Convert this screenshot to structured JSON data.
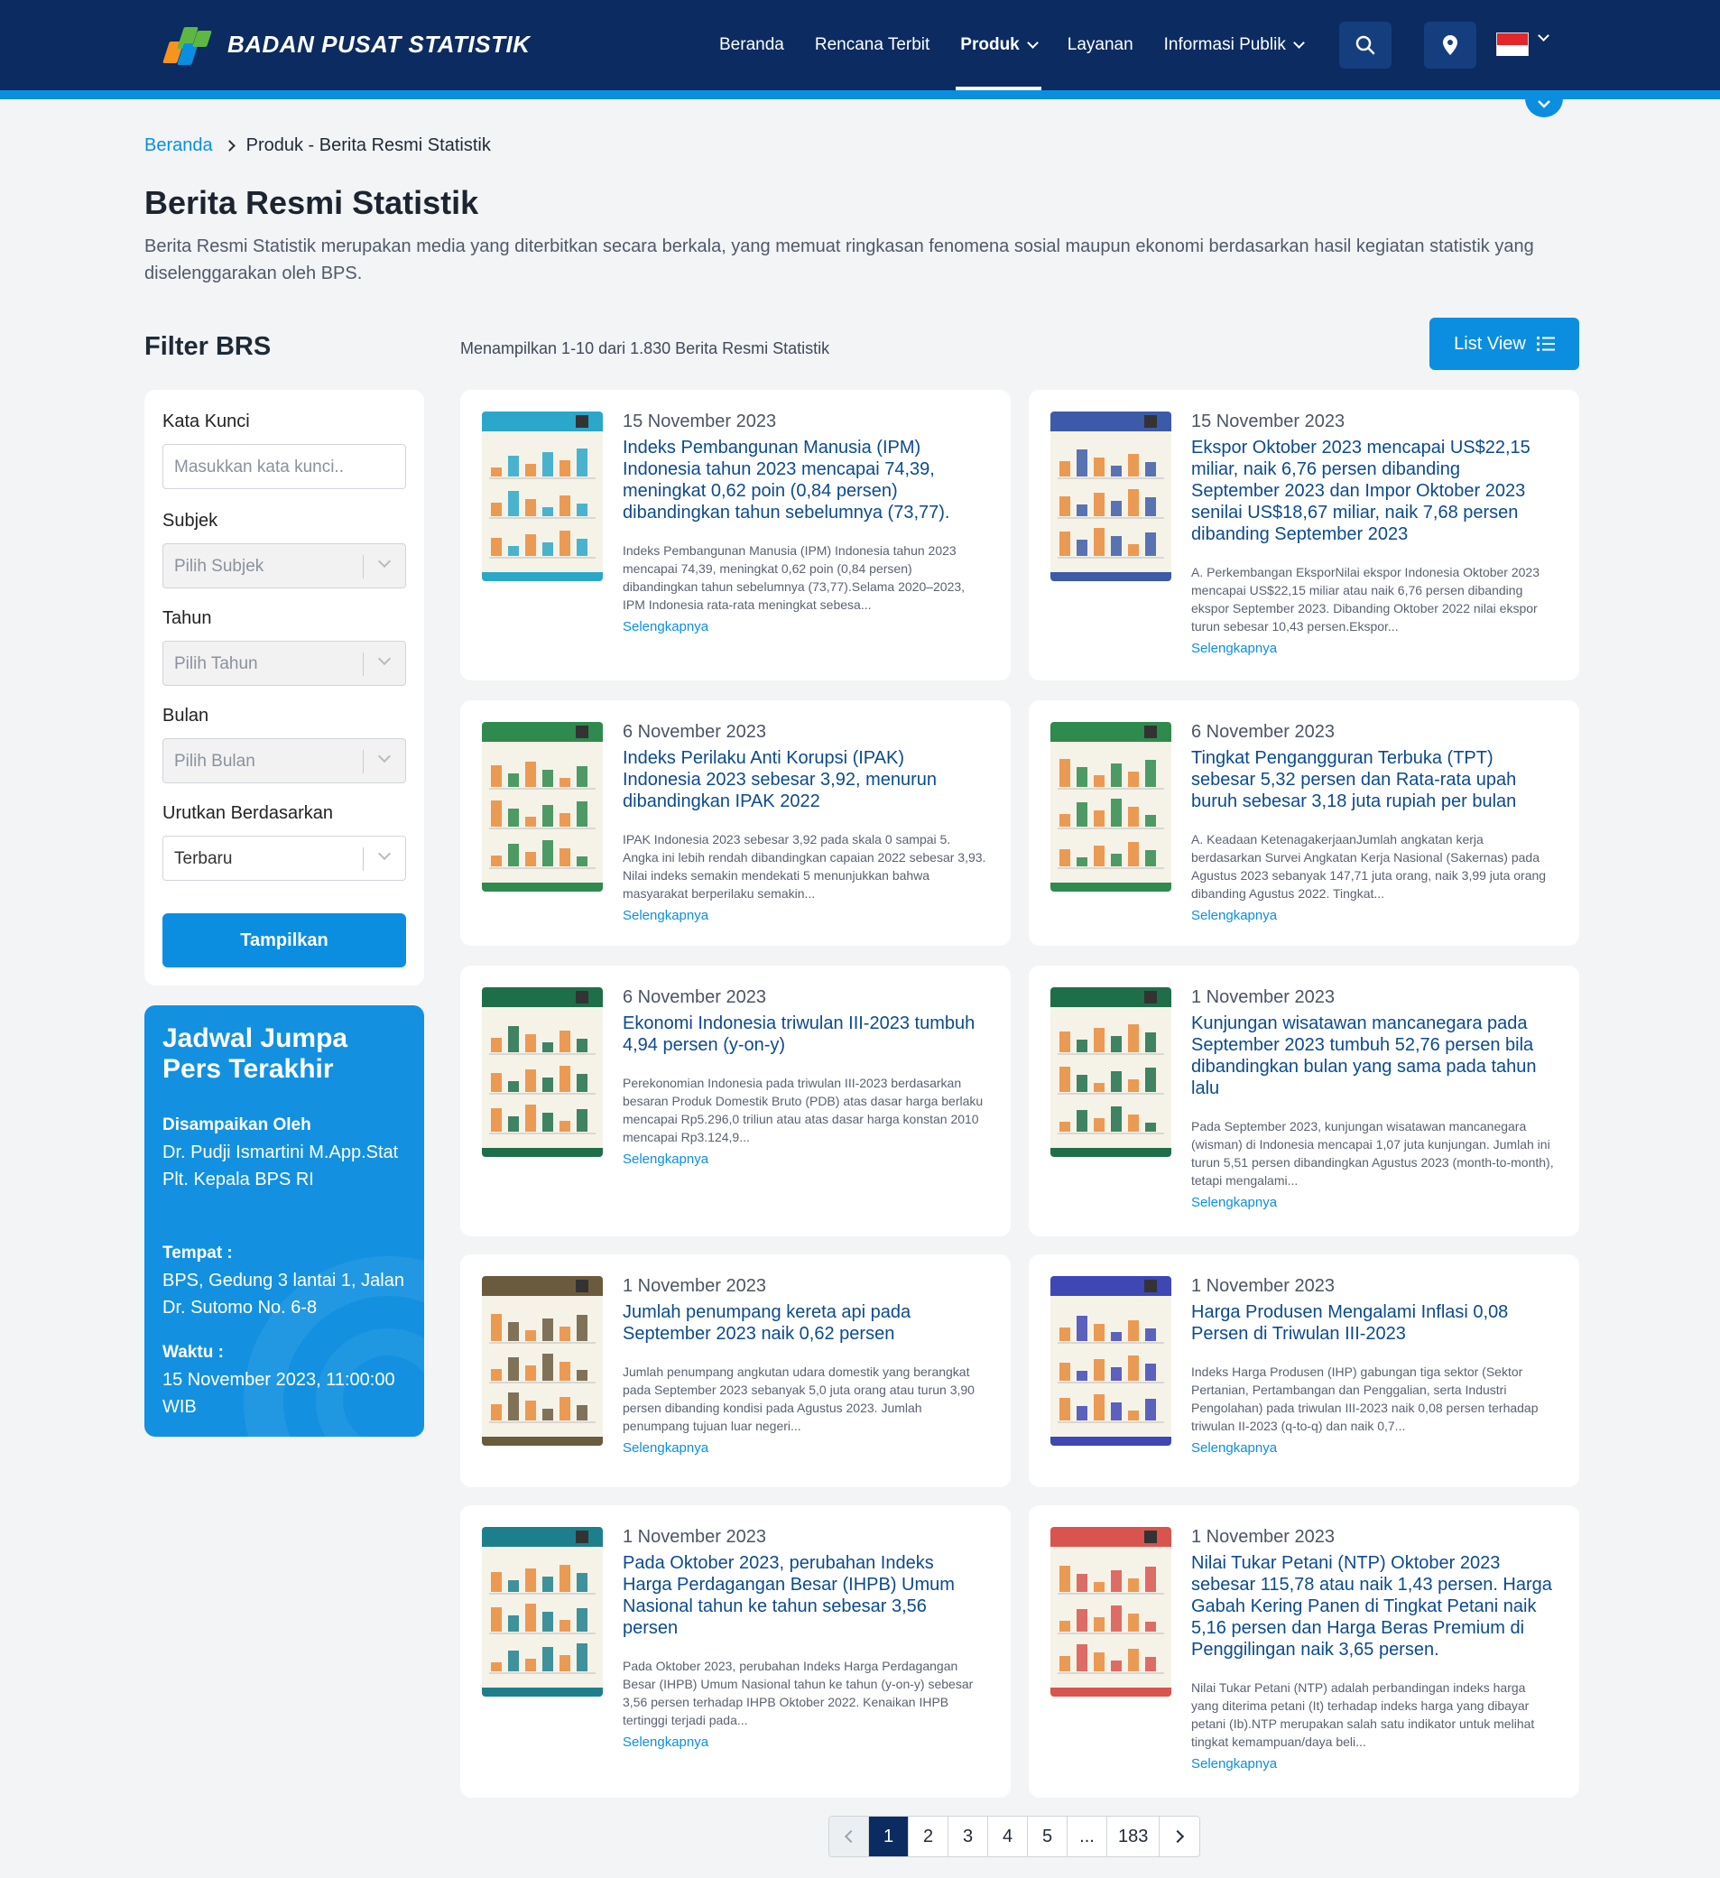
{
  "header": {
    "brand": "BADAN PUSAT STATISTIK",
    "nav": [
      {
        "label": "Beranda",
        "dropdown": false
      },
      {
        "label": "Rencana Terbit",
        "dropdown": false
      },
      {
        "label": "Produk",
        "dropdown": true,
        "active": true
      },
      {
        "label": "Layanan",
        "dropdown": false
      },
      {
        "label": "Informasi Publik",
        "dropdown": true
      }
    ],
    "icons": [
      "search-icon",
      "location-pin-icon",
      "indonesia-flag-icon"
    ],
    "colors": {
      "navy": "#0b2b61",
      "accent": "#0c8ee0"
    }
  },
  "breadcrumb": {
    "home": "Beranda",
    "current": "Produk - Berita Resmi Statistik"
  },
  "page": {
    "title": "Berita Resmi Statistik",
    "description": "Berita Resmi Statistik merupakan media yang diterbitkan secara berkala, yang memuat ringkasan fenomena sosial maupun ekonomi berdasarkan hasil kegiatan statistik yang diselenggarakan oleh BPS."
  },
  "filter": {
    "title": "Filter BRS",
    "keyword_label": "Kata Kunci",
    "keyword_placeholder": "Masukkan kata kunci..",
    "subject_label": "Subjek",
    "subject_value": "Pilih Subjek",
    "year_label": "Tahun",
    "year_value": "Pilih Tahun",
    "month_label": "Bulan",
    "month_value": "Pilih Bulan",
    "sort_label": "Urutkan Berdasarkan",
    "sort_value": "Terbaru",
    "submit": "Tampilkan"
  },
  "press": {
    "title": "Jadwal Jumpa Pers Terakhir",
    "by_label": "Disampaikan Oleh",
    "by_value": "Dr. Pudji Ismartini M.App.Stat Plt. Kepala BPS RI",
    "place_label": "Tempat :",
    "place_value": "BPS, Gedung 3 lantai 1, Jalan Dr. Sutomo No. 6-8",
    "time_label": "Waktu :",
    "time_value": "15 November 2023, 11:00:00 WIB"
  },
  "results": {
    "count_text": "Menampilkan 1-10 dari 1.830 Berita Resmi Statistik",
    "list_view_label": "List View",
    "more_label": "Selengkapnya",
    "items": [
      {
        "date": "15 November 2023",
        "title": "Indeks Pembangunan Manusia (IPM) Indonesia tahun 2023 mencapai 74,39, meningkat 0,62 poin (0,84 persen) dibandingkan tahun sebelumnya (73,77).",
        "abstract": "Indeks Pembangunan Manusia (IPM) Indonesia tahun 2023 mencapai 74,39, meningkat 0,62 poin (0,84 persen) dibandingkan tahun sebelumnya (73,77).Selama 2020–2023, IPM Indonesia rata-rata meningkat sebesa...",
        "thumb_color": "#2aa7c9"
      },
      {
        "date": "15 November 2023",
        "title": "Ekspor Oktober 2023 mencapai US$22,15 miliar, naik 6,76 persen dibanding September 2023 dan Impor Oktober 2023 senilai US$18,67 miliar, naik 7,68 persen dibanding September 2023",
        "abstract": "A. Perkembangan EksporNilai ekspor Indonesia Oktober 2023 mencapai US$22,15 miliar atau naik 6,76 persen dibanding ekspor September 2023. Dibanding Oktober 2022 nilai ekspor turun sebesar 10,43 persen.Ekspor...",
        "thumb_color": "#3d5aa8"
      },
      {
        "date": "6 November 2023",
        "title": "Indeks Perilaku Anti Korupsi (IPAK) Indonesia 2023 sebesar 3,92, menurun dibandingkan IPAK 2022",
        "abstract": "IPAK Indonesia 2023 sebesar 3,92 pada skala 0 sampai 5. Angka ini lebih rendah dibandingkan capaian 2022 sebesar 3,93. Nilai indeks semakin mendekati 5 menunjukkan bahwa masyarakat berperilaku semakin...",
        "thumb_color": "#2f8a4e"
      },
      {
        "date": "6 November 2023",
        "title": "Tingkat Pengangguran Terbuka (TPT) sebesar 5,32 persen dan Rata-rata upah buruh sebesar 3,18 juta rupiah per bulan",
        "abstract": "A. Keadaan KetenagakerjaanJumlah angkatan kerja berdasarkan Survei Angkatan Kerja Nasional (Sakernas) pada Agustus 2023 sebanyak 147,71 juta orang, naik 3,99 juta orang dibanding Agustus 2022. Tingkat...",
        "thumb_color": "#2f8a4e"
      },
      {
        "date": "6 November 2023",
        "title": "Ekonomi Indonesia triwulan III-2023 tumbuh 4,94 persen (y-on-y)",
        "abstract": "Perekonomian Indonesia pada triwulan III-2023 berdasarkan besaran Produk Domestik Bruto (PDB) atas dasar harga berlaku mencapai Rp5.296,0 triliun atau atas dasar harga konstan 2010 mencapai Rp3.124,9...",
        "thumb_color": "#1f6e4a"
      },
      {
        "date": "1 November 2023",
        "title": "Kunjungan wisatawan mancanegara pada September 2023 tumbuh 52,76 persen bila dibandingkan bulan yang sama pada tahun lalu",
        "abstract": "Pada September 2023, kunjungan wisatawan mancanegara (wisman) di Indonesia mencapai 1,07 juta kunjungan. Jumlah ini turun 5,51 persen dibandingkan Agustus 2023 (month-to-month), tetapi mengalami...",
        "thumb_color": "#1f6e4a"
      },
      {
        "date": "1 November 2023",
        "title": "Jumlah penumpang kereta api pada September 2023 naik 0,62 persen",
        "abstract": "Jumlah penumpang angkutan udara domestik yang berangkat pada September 2023 sebanyak 5,0 juta orang atau turun 3,90 persen dibanding kondisi pada Agustus 2023. Jumlah penumpang tujuan luar negeri...",
        "thumb_color": "#6b5b3e"
      },
      {
        "date": "1 November 2023",
        "title": "Harga Produsen Mengalami Inflasi 0,08 Persen di Triwulan III-2023",
        "abstract": "Indeks Harga Produsen (IHP) gabungan tiga sektor (Sektor Pertanian, Pertambangan dan Penggalian, serta Industri Pengolahan) pada triwulan III-2023 naik 0,08 persen terhadap triwulan II-2023 (q-to-q) dan naik 0,7...",
        "thumb_color": "#3f47b5"
      },
      {
        "date": "1 November 2023",
        "title": "Pada Oktober 2023, perubahan Indeks Harga Perdagangan Besar (IHPB) Umum Nasional tahun ke tahun sebesar 3,56 persen",
        "abstract": "Pada Oktober 2023, perubahan Indeks Harga Perdagangan Besar (IHPB) Umum Nasional tahun ke tahun (y-on-y) sebesar 3,56 persen terhadap IHPB Oktober 2022. Kenaikan IHPB tertinggi terjadi pada...",
        "thumb_color": "#1e7f8c"
      },
      {
        "date": "1 November 2023",
        "title": "Nilai Tukar Petani (NTP) Oktober 2023 sebesar 115,78 atau naik 1,43 persen. Harga Gabah Kering Panen di Tingkat Petani naik 5,16 persen dan Harga Beras Premium di Penggilingan naik 3,65 persen.",
        "abstract": "Nilai Tukar Petani (NTP) adalah perbandingan indeks harga yang diterima petani (It) terhadap indeks harga yang dibayar petani (Ib).NTP merupakan salah satu indikator untuk melihat tingkat kemampuan/daya beli...",
        "thumb_color": "#d9534f"
      }
    ]
  },
  "pagination": {
    "pages": [
      "1",
      "2",
      "3",
      "4",
      "5",
      "...",
      "183"
    ],
    "current": "1"
  }
}
